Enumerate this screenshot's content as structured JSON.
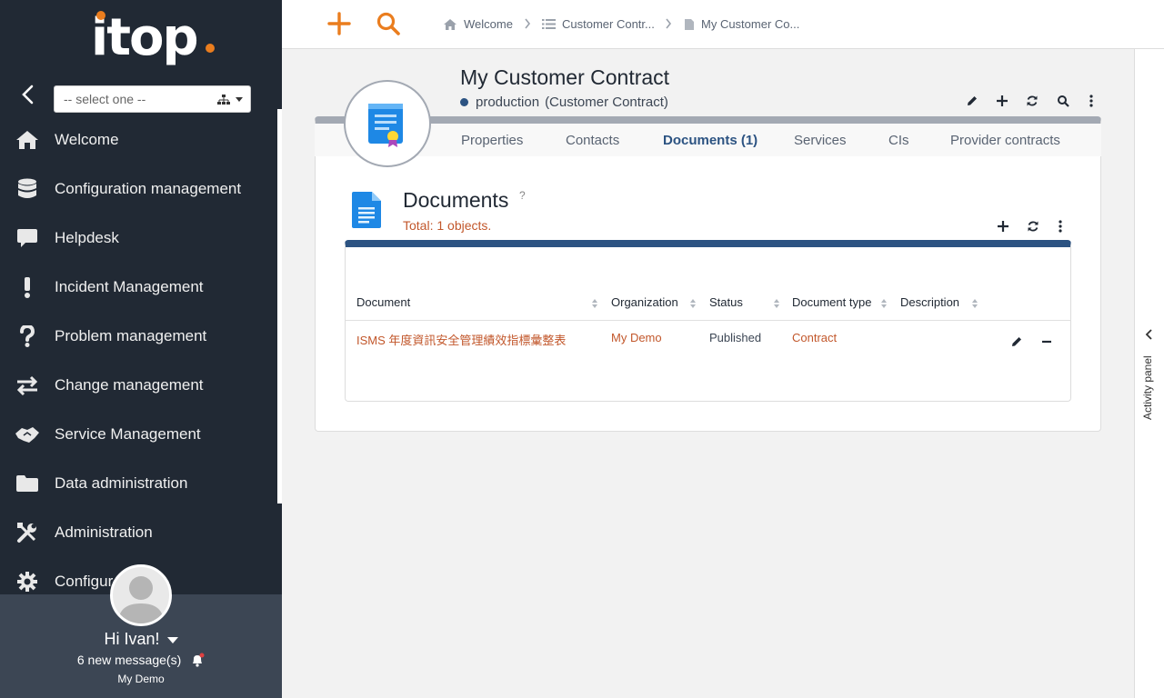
{
  "sidebar": {
    "logo_text": "itop",
    "org_select": {
      "value": "-- select one --"
    },
    "menu": [
      {
        "label": "Welcome",
        "icon": "home-icon"
      },
      {
        "label": "Configuration management",
        "icon": "database-icon"
      },
      {
        "label": "Helpdesk",
        "icon": "chat-bubble-icon"
      },
      {
        "label": "Incident Management",
        "icon": "exclamation-icon"
      },
      {
        "label": "Problem management",
        "icon": "question-icon"
      },
      {
        "label": "Change management",
        "icon": "exchange-arrows-icon"
      },
      {
        "label": "Service Management",
        "icon": "handshake-icon"
      },
      {
        "label": "Data administration",
        "icon": "folder-icon"
      },
      {
        "label": "Administration",
        "icon": "tools-icon"
      },
      {
        "label": "Configur",
        "icon": "gear-icon"
      }
    ],
    "user": {
      "greeting": "Hi Ivan!",
      "messages": "6 new message(s)",
      "organization": "My Demo"
    }
  },
  "topbar": {
    "breadcrumbs": [
      {
        "label": "Welcome",
        "icon": "home-icon"
      },
      {
        "label": "Customer Contr...",
        "icon": "list-icon"
      },
      {
        "label": "My Customer Co...",
        "icon": "document-icon"
      }
    ]
  },
  "object": {
    "title": "My Customer Contract",
    "status": "production",
    "class_label": "(Customer Contract)",
    "tabs": [
      {
        "label": "Properties",
        "active": false
      },
      {
        "label": "Contacts",
        "active": false
      },
      {
        "label": "Documents (1)",
        "active": true
      },
      {
        "label": "Services",
        "active": false
      },
      {
        "label": "CIs",
        "active": false
      },
      {
        "label": "Provider contracts",
        "active": false
      }
    ]
  },
  "documents": {
    "title": "Documents",
    "help": "?",
    "total": "Total: 1 objects.",
    "columns": [
      "Document",
      "Organization",
      "Status",
      "Document type",
      "Description"
    ],
    "rows": [
      {
        "document": "ISMS 年度資訊安全管理績效指標彙整表",
        "organization": "My Demo",
        "status": "Published",
        "document_type": "Contract",
        "description": ""
      }
    ]
  },
  "activity_panel": {
    "label": "Activity panel"
  },
  "colors": {
    "sidebar_bg": "#212934",
    "accent_orange": "#ea7d1e",
    "link": "#c2572b",
    "primary_blue": "#2c5382"
  }
}
